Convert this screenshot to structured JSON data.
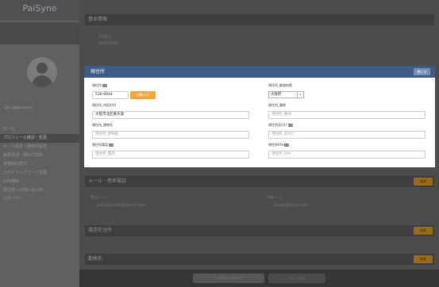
{
  "sidebar": {
    "brand": "PaiSyne",
    "email": "pai...@gmail.com",
    "nav": [
      "ホーム",
      "プロフィール確認・変更",
      "メール設定・通知の設定",
      "免責事項・規約の同意",
      "各種解約案内",
      "ログインパスワード変更",
      "利用規約",
      "運営者への問い合わせ",
      "ログアウト"
    ],
    "active_index": 1
  },
  "main": {
    "basic_section": "基本情報",
    "member_no_label": "会員番号",
    "member_no_value": "00000000",
    "mail_section": "メール・携帯電話",
    "pc_mail_label": "登録メール",
    "pc_mail_value": "paisyne.dev@gmail.com",
    "mobile_mail_label": "予備メール",
    "mobile_mail_value": "sxpsg@xcjxy.com",
    "billing_section": "請求先住所",
    "work_section": "勤務先",
    "edit_label": "編集"
  },
  "modal": {
    "title": "現住所",
    "close_label": "閉じる",
    "required_badge": "必須",
    "postal": {
      "label": "現住所",
      "value": "530-0044",
      "button": "自動入力"
    },
    "prefecture": {
      "label": "現住所_都道府県",
      "value": "大阪府"
    },
    "city": {
      "label": "現住所_市区町村",
      "value": "大阪市北区東天満"
    },
    "street": {
      "label": "現住所_番地",
      "placeholder": "現住所_番地"
    },
    "building": {
      "label": "現住所_建物名",
      "placeholder": "現住所_建物名"
    },
    "care_of": {
      "label": "現住所気付け",
      "placeholder": "現住所_気付け"
    },
    "phone": {
      "label": "現住所電話",
      "placeholder": "現住所_電話"
    },
    "fax": {
      "label": "現住所FAX",
      "placeholder": "現住所_FAX"
    }
  },
  "footer": {
    "save_label": "この内容で保存する",
    "cancel_label": "キャンセル"
  }
}
